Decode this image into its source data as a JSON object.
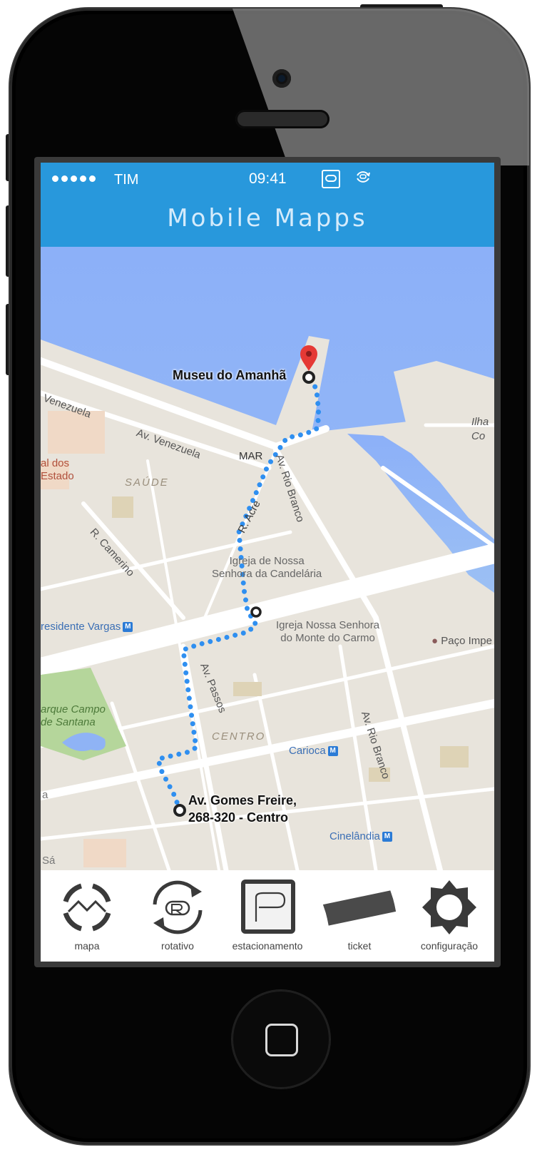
{
  "status_bar": {
    "carrier": "TIM",
    "time": "09:41"
  },
  "header": {
    "app_title": "Mobile Mapps"
  },
  "map": {
    "origin_label_line1": "Av. Gomes Freire,",
    "origin_label_line2": "268-320 - Centro",
    "destination_label": "Museu do Amanhã",
    "route_color": "#2f8ff0",
    "pin_color": "#e53935",
    "water_color": "#8fb3f5",
    "land_color": "#e8e4dc",
    "park_color": "#b5d69b",
    "streets": {
      "venezuela_1": "Venezuela",
      "venezuela_2": "Av. Venezuela",
      "rio_branco_1": "Av. Rio Branco",
      "rio_branco_2": "Av. Rio Branco",
      "camerino": "R. Camerino",
      "acre": "R. Acre",
      "passos": "Av. Passos",
      "pres_vargas": "residente Vargas"
    },
    "places": {
      "mar": "MAR",
      "saude": "SAÚDE",
      "centro": "CENTRO",
      "hospital": "al dos\nEstado",
      "candelaria": "Igreja de Nossa\nSenhora da Candelária",
      "monte_carmo": "Igreja Nossa Senhora\ndo Monte do Carmo",
      "paco": "Paço Impe",
      "carioca": "Carioca",
      "cinelandia": "Cinelândia",
      "campo_santana": "arque Campo\nde Santana",
      "ilha": "Ilha\nCo",
      "sa": "Sá",
      "a": "a"
    },
    "metro_symbol": "M"
  },
  "nav": {
    "items": [
      {
        "label": "mapa",
        "icon": "map-compass-icon"
      },
      {
        "label": "rotativo",
        "icon": "rotary-parking-icon"
      },
      {
        "label": "estacionamento",
        "icon": "parking-icon"
      },
      {
        "label": "ticket",
        "icon": "ticket-icon"
      },
      {
        "label": "configuração",
        "icon": "gear-icon"
      }
    ]
  }
}
